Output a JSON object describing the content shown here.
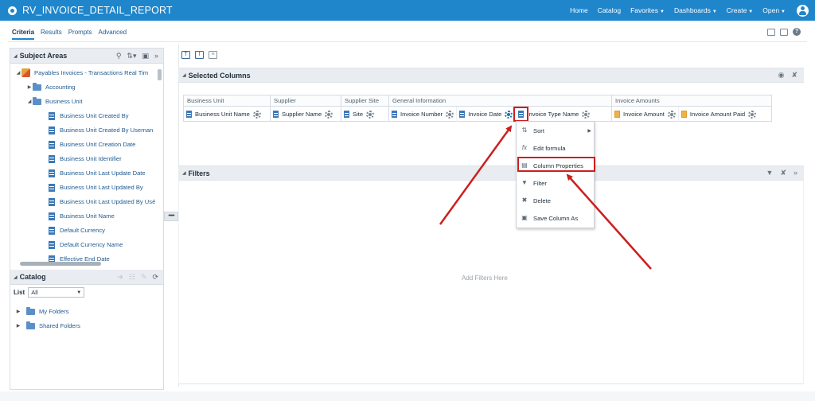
{
  "header": {
    "title": "RV_INVOICE_DETAIL_REPORT",
    "nav": [
      "Home",
      "Catalog",
      "Favorites",
      "Dashboards",
      "Create",
      "Open"
    ]
  },
  "tabs": [
    "Criteria",
    "Results",
    "Prompts",
    "Advanced"
  ],
  "subject_areas": {
    "title": "Subject Areas",
    "tree": [
      {
        "label": "Payables Invoices - Transactions Real Tim",
        "type": "subject"
      },
      {
        "label": "Accounting",
        "type": "folder"
      },
      {
        "label": "Business Unit",
        "type": "folder"
      },
      {
        "label": "Business Unit Created By",
        "type": "column"
      },
      {
        "label": "Business Unit Created By Usernan",
        "type": "column"
      },
      {
        "label": "Business Unit Creation Date",
        "type": "column"
      },
      {
        "label": "Business Unit Identifier",
        "type": "column"
      },
      {
        "label": "Business Unit Last Update Date",
        "type": "column"
      },
      {
        "label": "Business Unit Last Updated By",
        "type": "column"
      },
      {
        "label": "Business Unit Last Updated By Usé",
        "type": "column"
      },
      {
        "label": "Business Unit Name",
        "type": "column"
      },
      {
        "label": "Default Currency",
        "type": "column"
      },
      {
        "label": "Default Currency Name",
        "type": "column"
      },
      {
        "label": "Effective End Date",
        "type": "column"
      }
    ]
  },
  "catalog": {
    "title": "Catalog",
    "list_label": "List",
    "list_value": "All",
    "folders": [
      "My Folders",
      "Shared Folders"
    ]
  },
  "selected_columns": {
    "title": "Selected Columns",
    "groups": [
      {
        "name": "Business Unit",
        "columns": [
          "Business Unit Name"
        ]
      },
      {
        "name": "Supplier",
        "columns": [
          "Supplier Name"
        ]
      },
      {
        "name": "Supplier Site",
        "columns": [
          "Site"
        ]
      },
      {
        "name": "General Information",
        "columns": [
          "Invoice Number",
          "Invoice Date",
          "Invoice Type Name"
        ]
      },
      {
        "name": "Invoice Amounts",
        "columns": [
          "Invoice Amount",
          "Invoice Amount Paid"
        ]
      }
    ]
  },
  "context_menu": {
    "items": [
      "Sort",
      "Edit formula",
      "Column Properties",
      "Filter",
      "Delete",
      "Save Column As"
    ],
    "highlighted": "Column Properties"
  },
  "filters": {
    "title": "Filters",
    "empty_text": "Add Filters Here"
  },
  "colors": {
    "header_bg": "#1f86cc",
    "annotation_red": "#cc1f1f"
  }
}
